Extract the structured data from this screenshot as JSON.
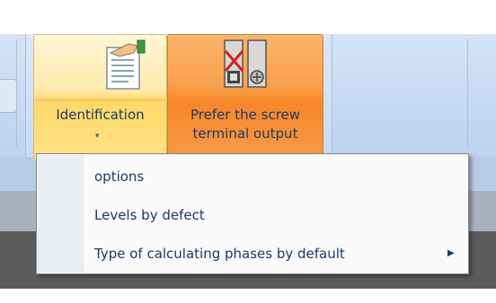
{
  "ribbon": {
    "identification_button": {
      "label": "Identification",
      "dropdown_arrow": "▾",
      "icon": "document-hand-icon"
    },
    "screw_terminal_button": {
      "label_line1": "Prefer the screw",
      "label_line2": "terminal output",
      "icon": "screw-terminal-icon"
    }
  },
  "dropdown_menu": {
    "items": [
      {
        "label": "options"
      },
      {
        "label": "Levels by defect"
      },
      {
        "label": "Type of calculating phases by default",
        "submenu_arrow": "▶"
      }
    ]
  },
  "colors": {
    "ribbon_bg": "#c6daf2",
    "hover_orange": "#f7862a",
    "hover_yellow": "#ffd865",
    "text_blue": "#1a3a6a"
  }
}
